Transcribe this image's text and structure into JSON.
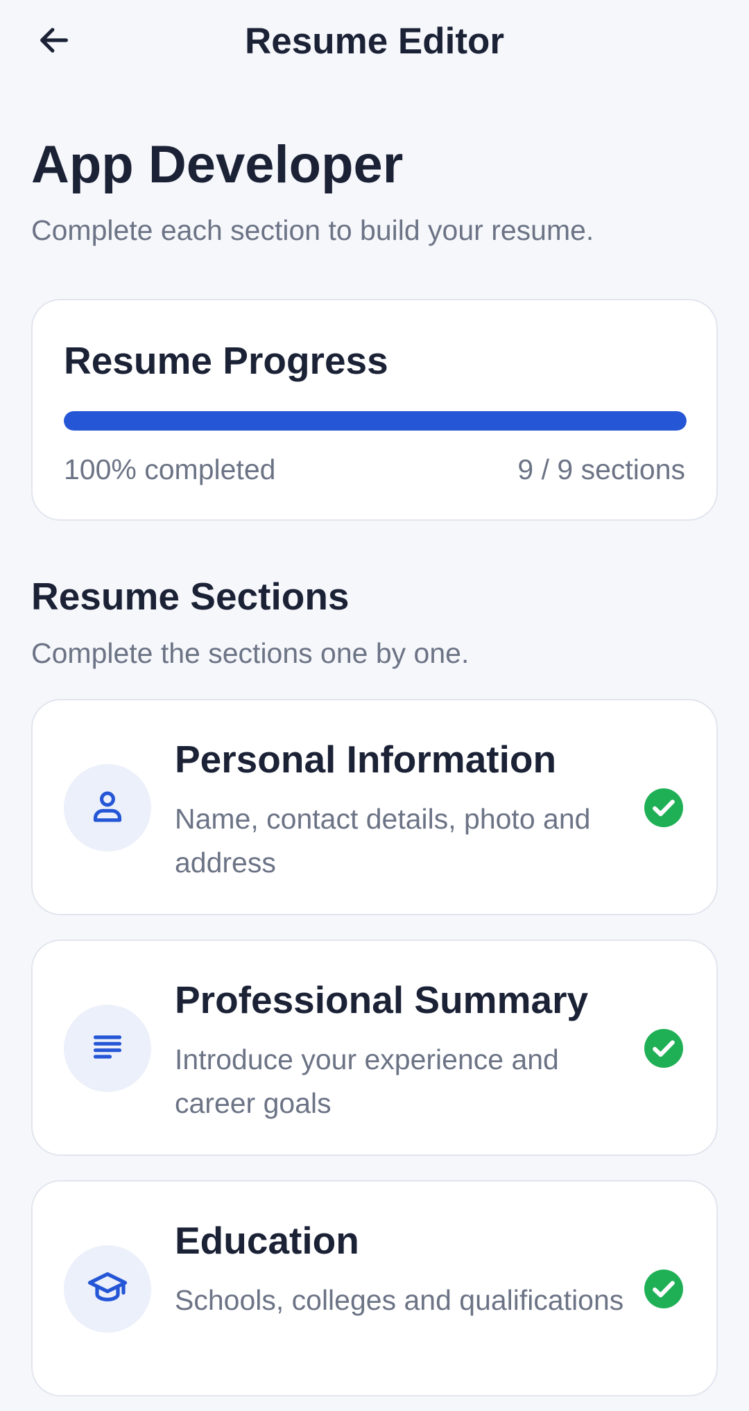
{
  "app_bar": {
    "title": "Resume Editor",
    "back_icon": "arrow-left-icon"
  },
  "header": {
    "title": "App Developer",
    "subtitle": "Complete each section to build your resume."
  },
  "progress": {
    "title": "Resume Progress",
    "percent_label": "100% completed",
    "sections_label": "9 / 9 sections",
    "fraction": 1.0,
    "fill_color": "#2456d6",
    "track_color": "#e4e8f4"
  },
  "sections_header": {
    "title": "Resume Sections",
    "subtitle": "Complete the sections one by one."
  },
  "sections": [
    {
      "name": "Personal Information",
      "description": "Name, contact details, photo and address",
      "icon": "person-icon",
      "completed": true
    },
    {
      "name": "Professional Summary",
      "description": "Introduce your experience and career goals",
      "icon": "text-lines-icon",
      "completed": true
    },
    {
      "name": "Education",
      "description": "Schools, colleges and qualifications",
      "icon": "graduation-cap-icon",
      "completed": true
    }
  ],
  "colors": {
    "accent": "#2456d6",
    "success": "#1fb056",
    "text_primary": "#1b2236",
    "text_secondary": "#6b7385",
    "background": "#f6f7fb"
  }
}
